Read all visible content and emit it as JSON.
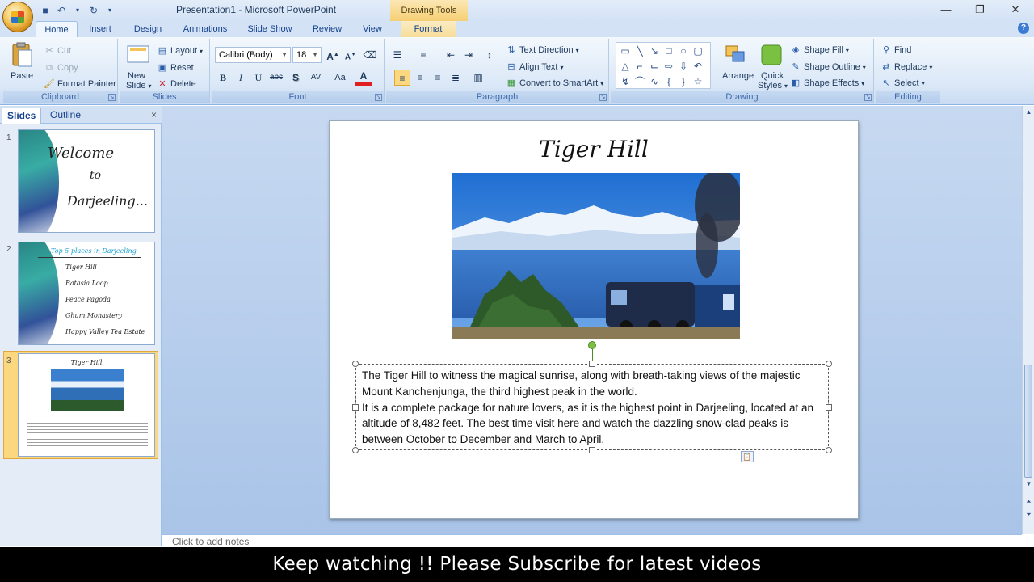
{
  "window": {
    "title": "Presentation1 - Microsoft PowerPoint",
    "contextual_tab_group": "Drawing Tools",
    "minimize": "—",
    "restore": "❐",
    "close": "✕"
  },
  "quick_access": [
    "save-icon",
    "undo-icon",
    "redo-icon",
    "customize-icon"
  ],
  "tabs": [
    "Home",
    "Insert",
    "Design",
    "Animations",
    "Slide Show",
    "Review",
    "View",
    "Format"
  ],
  "ribbon": {
    "clipboard": {
      "label": "Clipboard",
      "paste": "Paste",
      "cut": "Cut",
      "copy": "Copy",
      "format_painter": "Format Painter"
    },
    "slides": {
      "label": "Slides",
      "new_slide": "New",
      "new_slide2": "Slide",
      "layout": "Layout",
      "reset": "Reset",
      "delete": "Delete"
    },
    "font": {
      "label": "Font",
      "font_name": "Calibri (Body)",
      "font_size": "18",
      "bold": "B",
      "italic": "I",
      "underline": "U",
      "strike": "abc",
      "shadow": "S",
      "spacing": "AV",
      "case": "Aa",
      "color": "A"
    },
    "paragraph": {
      "label": "Paragraph",
      "text_direction": "Text Direction",
      "align_text": "Align Text",
      "convert_smartart": "Convert to SmartArt"
    },
    "drawing": {
      "label": "Drawing",
      "arrange": "Arrange",
      "quick_styles": "Quick",
      "quick_styles2": "Styles",
      "shape_fill": "Shape Fill",
      "shape_outline": "Shape Outline",
      "shape_effects": "Shape Effects"
    },
    "editing": {
      "label": "Editing",
      "find": "Find",
      "replace": "Replace",
      "select": "Select"
    }
  },
  "left_pane": {
    "tabs": [
      "Slides",
      "Outline"
    ],
    "close": "×",
    "slide1": {
      "num": "1",
      "line1": "Welcome",
      "line2": "to",
      "line3": "Darjeeling..."
    },
    "slide2": {
      "num": "2",
      "title": "Top 5 places in Darjeeling",
      "items": [
        "Tiger Hill",
        "Batasia Loop",
        "Peace Pagoda",
        "Ghum Monastery",
        "Happy Valley Tea Estate"
      ]
    },
    "slide3": {
      "num": "3",
      "title": "Tiger Hill"
    }
  },
  "slide": {
    "title": "Tiger Hill",
    "paragraph1": "The Tiger Hill to witness the magical sunrise, along with breath-taking views of the majestic Mount Kanchenjunga, the third highest peak in the world.",
    "paragraph2": "It is a complete package for nature lovers, as it is the highest point in Darjeeling, located at an altitude of 8,482 feet. The best time visit here and watch the dazzling snow-clad peaks is between October to December and March to April."
  },
  "notes_placeholder": "Click to add notes",
  "caption": "Keep watching !! Please Subscribe for latest videos"
}
